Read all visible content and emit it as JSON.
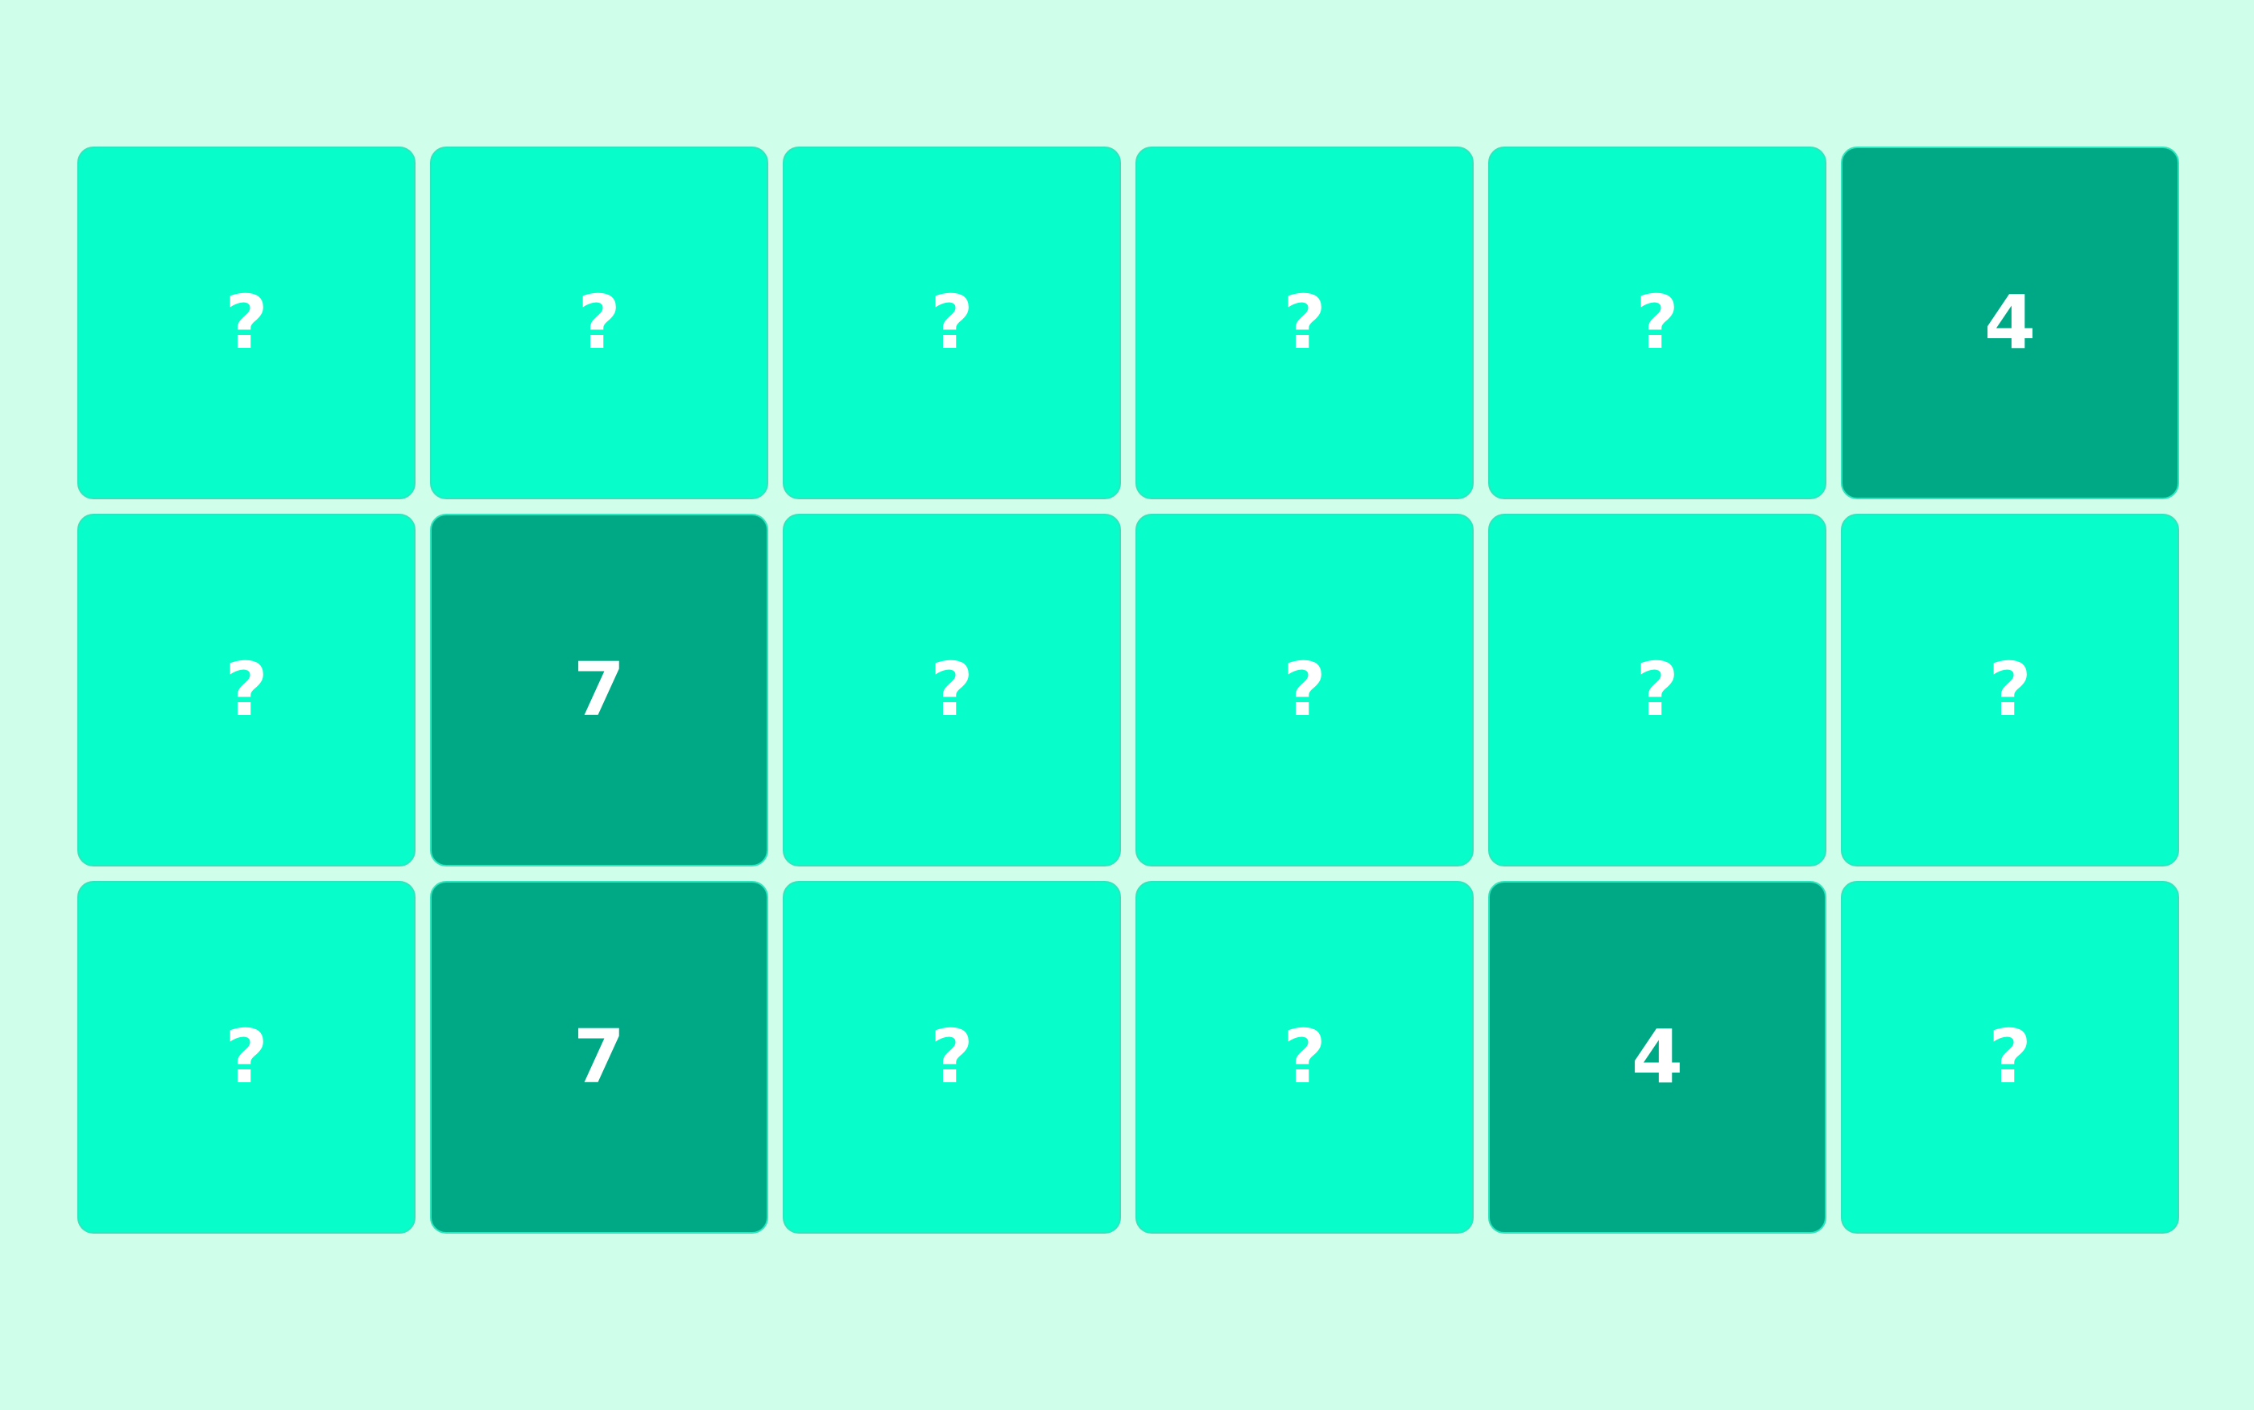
{
  "colors": {
    "background": "#cffeea",
    "card_hidden": "#07fdc9",
    "card_revealed": "#00a985",
    "card_text": "#ffffff"
  },
  "board": {
    "rows": 3,
    "columns": 6,
    "cards": [
      {
        "label": "?",
        "state": "hidden"
      },
      {
        "label": "?",
        "state": "hidden"
      },
      {
        "label": "?",
        "state": "hidden"
      },
      {
        "label": "?",
        "state": "hidden"
      },
      {
        "label": "?",
        "state": "hidden"
      },
      {
        "label": "4",
        "state": "revealed"
      },
      {
        "label": "?",
        "state": "hidden"
      },
      {
        "label": "7",
        "state": "revealed"
      },
      {
        "label": "?",
        "state": "hidden"
      },
      {
        "label": "?",
        "state": "hidden"
      },
      {
        "label": "?",
        "state": "hidden"
      },
      {
        "label": "?",
        "state": "hidden"
      },
      {
        "label": "?",
        "state": "hidden"
      },
      {
        "label": "7",
        "state": "revealed"
      },
      {
        "label": "?",
        "state": "hidden"
      },
      {
        "label": "?",
        "state": "hidden"
      },
      {
        "label": "4",
        "state": "revealed"
      },
      {
        "label": "?",
        "state": "hidden"
      }
    ]
  }
}
